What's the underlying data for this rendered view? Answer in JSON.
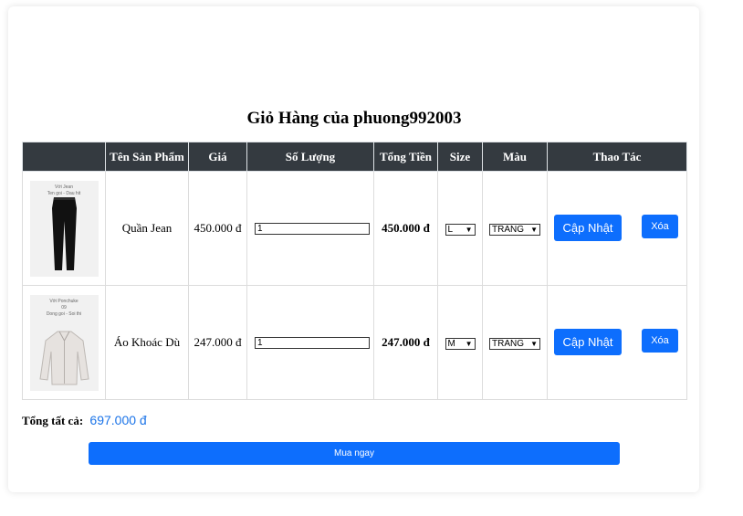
{
  "cart": {
    "title": "Giỏ Hàng của phuong992003",
    "columns": [
      "",
      "Tên Sản Phẩm",
      "Giá",
      "Số Lượng",
      "Tổng Tiền",
      "Size",
      "Màu",
      "Thao Tác"
    ],
    "items": [
      {
        "name": "Quần Jean",
        "price": "450.000 đ",
        "quantity": "1",
        "total": "450.000 đ",
        "size": "L",
        "color": "TRANG",
        "thumb_caption": "Với Jean\nTen goi - Dau hit",
        "update_label": "Cập Nhật",
        "delete_label": "Xóa"
      },
      {
        "name": "Áo Khoác Dù",
        "price": "247.000 đ",
        "quantity": "1",
        "total": "247.000 đ",
        "size": "M",
        "color": "TRANG",
        "thumb_caption": "Với Ponchuke\n09\nDong goi - Soi thi",
        "update_label": "Cập Nhật",
        "delete_label": "Xóa"
      }
    ],
    "grand_total_label": "Tổng tất cả:",
    "grand_total": "697.000 đ",
    "buy_label": "Mua ngay"
  },
  "colors": {
    "header_bg": "#343a40",
    "primary": "#0d6efd",
    "total_amount": "#1a73e8"
  }
}
